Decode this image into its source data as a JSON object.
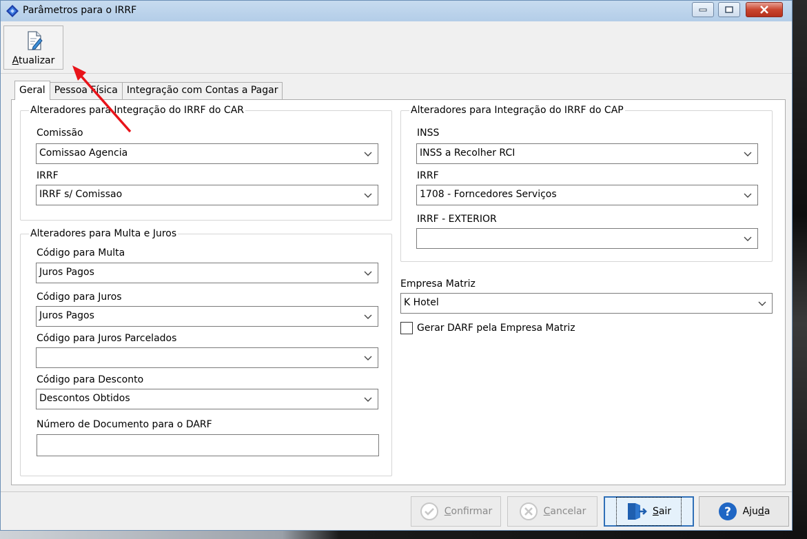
{
  "window": {
    "title": "Parâmetros para o IRRF"
  },
  "toolbar": {
    "atualizar_first": "A",
    "atualizar_rest": "tualizar"
  },
  "tabs": [
    {
      "label": "Geral",
      "active": true
    },
    {
      "label": "Pessoa Física",
      "active": false
    },
    {
      "label": "Integração com Contas a Pagar",
      "active": false
    }
  ],
  "car_group": {
    "legend": "Alteradores para Integração do IRRF do CAR",
    "comissao_label": "Comissão",
    "comissao_value": "Comissao Agencia",
    "irrf_label": "IRRF",
    "irrf_value": "IRRF s/ Comissao"
  },
  "cap_group": {
    "legend": "Alteradores para Integração do IRRF do CAP",
    "inss_label": "INSS",
    "inss_value": "INSS a Recolher RCI",
    "irrf_label": "IRRF",
    "irrf_value": "1708 - Forncedores Serviços",
    "irrf_ext_label": "IRRF - EXTERIOR",
    "irrf_ext_value": ""
  },
  "multa_group": {
    "legend": "Alteradores para Multa e Juros",
    "multa_label": "Código para Multa",
    "multa_value": "Juros Pagos",
    "juros_label": "Código para Juros",
    "juros_value": "Juros Pagos",
    "juros_parc_label": "Código para Juros Parcelados",
    "juros_parc_value": "",
    "desconto_label": "Código para Desconto",
    "desconto_value": "Descontos Obtidos",
    "num_doc_label": "Número de Documento para o DARF",
    "num_doc_value": ""
  },
  "empresa": {
    "label": "Empresa Matriz",
    "value": "K Hotel",
    "checkbox_label": "Gerar DARF pela Empresa Matriz",
    "checked": false
  },
  "footer": {
    "confirmar_first": "C",
    "confirmar_rest": "onfirmar",
    "cancelar_first": "C",
    "cancelar_rest": "ancelar",
    "sair_first": "S",
    "sair_rest": "air",
    "ajuda_pre": "Aju",
    "ajuda_u": "d",
    "ajuda_post": "a"
  },
  "colors": {
    "title_bar": "#b3cde8",
    "annotation_arrow": "#e8141a",
    "help_blue": "#1f66c4"
  }
}
